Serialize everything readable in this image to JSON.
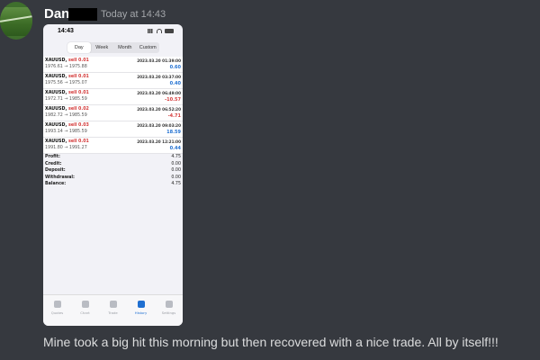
{
  "message": {
    "username": "Dan",
    "timestamp": "Today at 14:43",
    "text": "Mine took a big hit this morning but then recovered with a nice trade. All by itself!!!"
  },
  "phone": {
    "time": "14:43",
    "tabs": [
      "Day",
      "Week",
      "Month",
      "Custom"
    ],
    "active_tab": "Day",
    "trades": [
      {
        "symbol": "XAUUSD,",
        "direction": "sell 0.01",
        "prices": "1976.61 → 1975.88",
        "date": "2023.03.20 01:39:00",
        "pl": "0.60",
        "pl_sign": "pos"
      },
      {
        "symbol": "XAUUSD,",
        "direction": "sell 0.01",
        "prices": "1975.56 → 1975.07",
        "date": "2023.03.20 03:37:00",
        "pl": "0.40",
        "pl_sign": "pos"
      },
      {
        "symbol": "XAUUSD,",
        "direction": "sell 0.01",
        "prices": "1972.71 → 1985.59",
        "date": "2023.03.20 06:49:00",
        "pl": "-10.57",
        "pl_sign": "neg"
      },
      {
        "symbol": "XAUUSD,",
        "direction": "sell 0.02",
        "prices": "1982.72 → 1985.59",
        "date": "2023.03.20 06:52:20",
        "pl": "-4.71",
        "pl_sign": "neg"
      },
      {
        "symbol": "XAUUSD,",
        "direction": "sell 0.03",
        "prices": "1993.14 → 1985.59",
        "date": "2023.03.20 09:03:20",
        "pl": "18.59",
        "pl_sign": "pos"
      },
      {
        "symbol": "XAUUSD,",
        "direction": "sell 0.01",
        "prices": "1991.80 → 1991.27",
        "date": "2023.03.20 12:21:00",
        "pl": "0.44",
        "pl_sign": "pos"
      }
    ],
    "summary": [
      {
        "label": "Profit:",
        "value": "4.75"
      },
      {
        "label": "Credit:",
        "value": "0.00"
      },
      {
        "label": "Deposit:",
        "value": "0.00"
      },
      {
        "label": "Withdrawal:",
        "value": "0.00"
      },
      {
        "label": "Balance:",
        "value": "4.75"
      }
    ],
    "bottom_tabs": [
      {
        "label": "Quotes",
        "icon": "quotes-icon"
      },
      {
        "label": "Chart",
        "icon": "chart-icon"
      },
      {
        "label": "Trade",
        "icon": "trade-icon"
      },
      {
        "label": "History",
        "icon": "history-icon"
      },
      {
        "label": "Settings",
        "icon": "settings-icon"
      }
    ],
    "active_bottom_tab": "History"
  },
  "colors": {
    "background": "#36393f",
    "profit_positive": "#1f6fd1",
    "profit_negative": "#d43b3b"
  }
}
